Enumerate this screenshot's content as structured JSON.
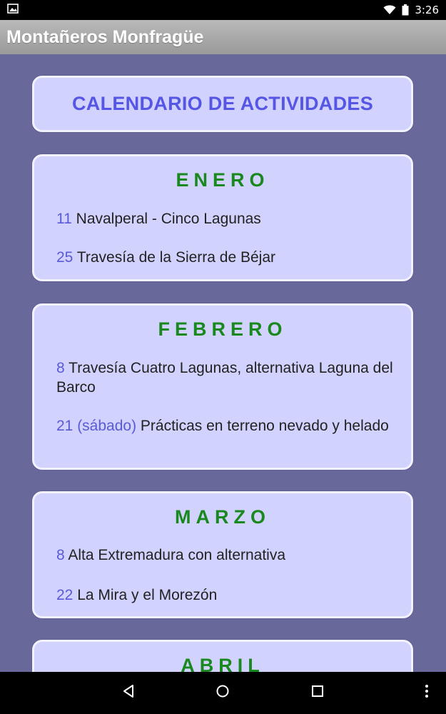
{
  "status_bar": {
    "time": "3:26",
    "icons": [
      "image-notification-icon",
      "wifi-icon",
      "battery-icon"
    ]
  },
  "app": {
    "title": "Montañeros Monfragüe"
  },
  "calendar": {
    "title": "CALENDARIO DE ACTIVIDADES",
    "months": [
      {
        "name": "ENERO",
        "activities": [
          {
            "day": "11",
            "text": "Navalperal - Cinco Lagunas"
          },
          {
            "day": "25",
            "text": "Travesía de la Sierra de Béjar"
          }
        ]
      },
      {
        "name": "FEBRERO",
        "activities": [
          {
            "day": "8",
            "text": "Travesía Cuatro Lagunas, alternativa Laguna del Barco"
          },
          {
            "day": "21 (sábado)",
            "text": "Prácticas en terreno nevado y helado"
          }
        ]
      },
      {
        "name": "MARZO",
        "activities": [
          {
            "day": "8",
            "text": "Alta Extremadura con alternativa"
          },
          {
            "day": "22",
            "text": "La Mira y el Morezón"
          }
        ]
      },
      {
        "name": "ABRIL",
        "activities": []
      }
    ]
  },
  "nav_bar": {
    "buttons": [
      "back-icon",
      "home-icon",
      "recents-icon",
      "menu-icon"
    ]
  },
  "colors": {
    "background": "#68689a",
    "card": "#d2d2ff",
    "card_title": "#5656e6",
    "month": "#19891f",
    "day": "#5a5ad8"
  }
}
